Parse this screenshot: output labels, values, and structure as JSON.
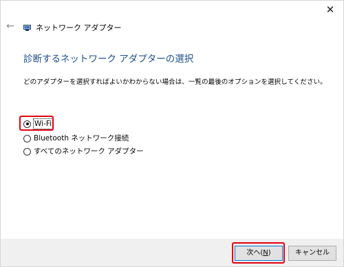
{
  "window": {
    "close_glyph": "✕",
    "back_glyph": "←"
  },
  "header": {
    "title": "ネットワーク アダプター",
    "icon": "network-adapter-icon"
  },
  "main": {
    "heading": "診断するネットワーク アダプターの選択",
    "instruction": "どのアダプターを選択すればよいかわからない場合は、一覧の最後のオプションを選択してください。",
    "options": [
      {
        "label": "Wi-Fi",
        "selected": true
      },
      {
        "label": "Bluetooth ネットワーク接続",
        "selected": false
      },
      {
        "label": "すべてのネットワーク アダプター",
        "selected": false
      }
    ]
  },
  "footer": {
    "next_label_prefix": "次へ(",
    "next_accel": "N",
    "next_label_suffix": ")",
    "cancel_label": "キャンセル"
  },
  "colors": {
    "heading": "#1c4e8b",
    "highlight": "#e1000f",
    "footer_bg": "#f0f0f0"
  }
}
